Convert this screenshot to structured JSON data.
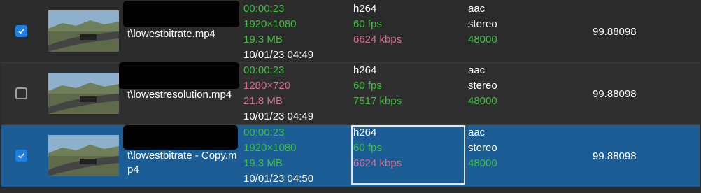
{
  "rows": [
    {
      "checked": true,
      "filename": "t\\lowestbitrate.mp4",
      "duration": "00:00:23",
      "resolution": "1920×1080",
      "size": "19.3 MB",
      "date": "10/01/23 04:49",
      "vcodec": "h264",
      "fps": "60 fps",
      "vbitrate": "6624 kbps",
      "acodec": "aac",
      "channels": "stereo",
      "samplerate": "48000",
      "score": "99.88098"
    },
    {
      "checked": false,
      "filename": "t\\lowestresolution.mp4",
      "duration": "00:00:23",
      "resolution": "1280×720",
      "size": "21.8 MB",
      "date": "10/01/23 04:49",
      "vcodec": "h264",
      "fps": "60 fps",
      "vbitrate": "7517 kbps",
      "acodec": "aac",
      "channels": "stereo",
      "samplerate": "48000",
      "score": "99.88098"
    },
    {
      "checked": true,
      "filename": "t\\lowestbitrate - Copy.mp4",
      "duration": "00:00:23",
      "resolution": "1920×1080",
      "size": "19.3 MB",
      "date": "10/01/23 04:50",
      "vcodec": "h264",
      "fps": "60 fps",
      "vbitrate": "6624 kbps",
      "acodec": "aac",
      "channels": "stereo",
      "samplerate": "48000",
      "score": "99.88098"
    }
  ],
  "colors": {
    "green": "#3fbf3f",
    "pink": "#d67093",
    "selected_row": "#1c5d95",
    "checkbox_checked": "#1f7fe0"
  },
  "icons": {
    "check": "checkmark-icon",
    "thumbnail": "video-thumbnail"
  }
}
